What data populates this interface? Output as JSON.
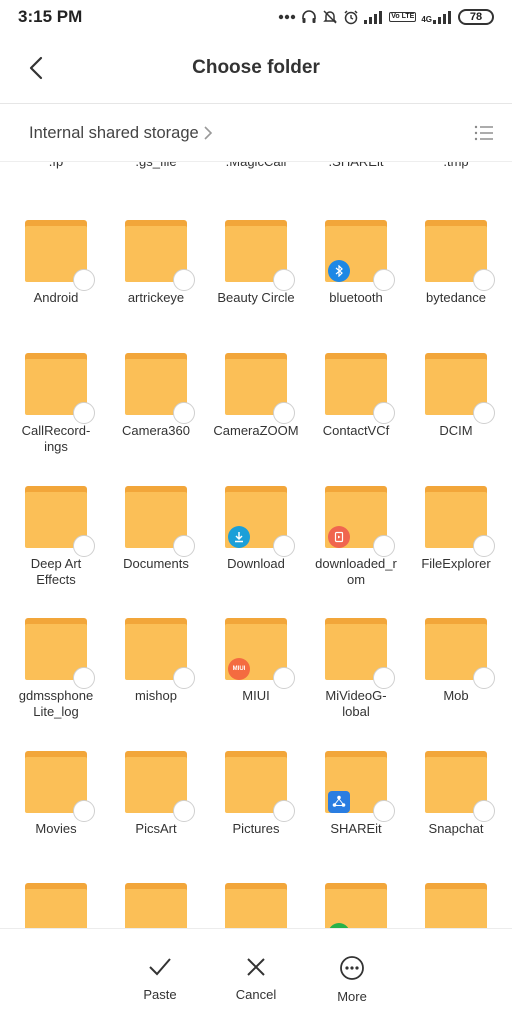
{
  "status": {
    "time": "3:15 PM",
    "battery": "78",
    "network_label": "4G",
    "volte_label": "Vo LTE"
  },
  "header": {
    "title": "Choose folder"
  },
  "path": {
    "breadcrumb": "Internal shared storage"
  },
  "cut_row": [
    ".fp",
    ".gs_file",
    ".MagicCall",
    ".SHAREit",
    ".tmp"
  ],
  "folders": [
    {
      "name": "Android"
    },
    {
      "name": "artrickeye"
    },
    {
      "name": "Beauty Circle"
    },
    {
      "name": "bluetooth",
      "badge": "bluetooth-icon",
      "badge_color": "#1e88e5"
    },
    {
      "name": "bytedance"
    },
    {
      "name": "CallRecord-\nings"
    },
    {
      "name": "Camera360"
    },
    {
      "name": "CameraZOOM"
    },
    {
      "name": "ContactVCf"
    },
    {
      "name": "DCIM"
    },
    {
      "name": "Deep Art\nEffects"
    },
    {
      "name": "Documents"
    },
    {
      "name": "Download",
      "badge": "download-icon",
      "badge_color": "#1b9fd8"
    },
    {
      "name": "downloaded_r\nom",
      "badge": "rom-icon",
      "badge_color": "#f0654f"
    },
    {
      "name": "FileExplorer"
    },
    {
      "name": "gdmssphone\nLite_log"
    },
    {
      "name": "mishop"
    },
    {
      "name": "MIUI",
      "badge": "miui-icon",
      "badge_text": "MIUI",
      "badge_color": "#f46b40"
    },
    {
      "name": "MiVideoG-\nlobal"
    },
    {
      "name": "Mob"
    },
    {
      "name": "Movies"
    },
    {
      "name": "PicsArt"
    },
    {
      "name": "Pictures"
    },
    {
      "name": "SHAREit",
      "badge": "shareit-icon",
      "badge_color": "#2a7de1"
    },
    {
      "name": "Snapchat"
    },
    {
      "name": ""
    },
    {
      "name": ""
    },
    {
      "name": ""
    },
    {
      "name": "",
      "badge": "green-app-icon",
      "badge_color": "#27b24a"
    },
    {
      "name": ""
    }
  ],
  "actions": [
    {
      "label": "Paste",
      "icon": "check-icon"
    },
    {
      "label": "Cancel",
      "icon": "close-icon"
    },
    {
      "label": "More",
      "icon": "more-icon"
    }
  ],
  "colors": {
    "folder_body": "#fbbf57",
    "folder_tab": "#f2a63a"
  }
}
